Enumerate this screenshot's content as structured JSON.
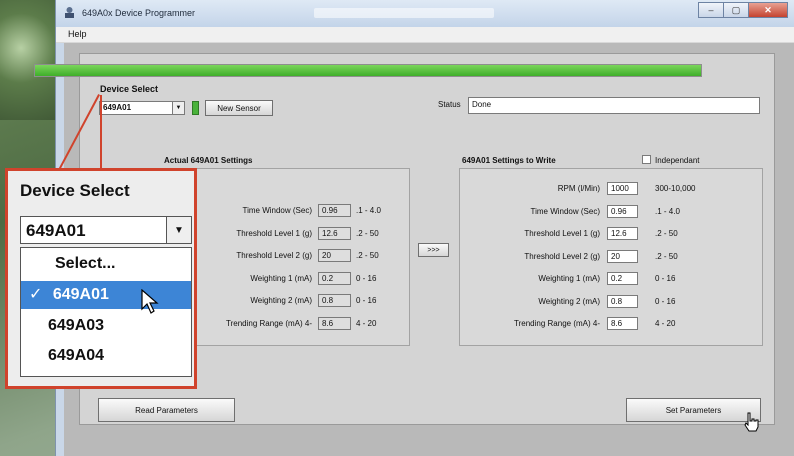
{
  "window": {
    "title": "649A0x Device Programmer"
  },
  "menu": {
    "help": "Help"
  },
  "progress": {
    "fraction": 1.0
  },
  "device_select": {
    "label": "Device Select",
    "selected": "649A01",
    "new_sensor_label": "New Sensor"
  },
  "status": {
    "label": "Status",
    "value": "Done"
  },
  "actual": {
    "heading": "Actual 649A01 Settings",
    "rows": [
      {
        "label": "Time Window (Sec)",
        "value": "0.96",
        "range": ".1 - 4.0"
      },
      {
        "label": "Threshold Level 1 (g)",
        "value": "12.6",
        "range": ".2 - 50"
      },
      {
        "label": "Threshold Level 2 (g)",
        "value": "20",
        "range": ".2 - 50"
      },
      {
        "label": "Weighting 1 (mA)",
        "value": "0.2",
        "range": "0 - 16"
      },
      {
        "label": "Weighting 2 (mA)",
        "value": "0.8",
        "range": "0 - 16"
      },
      {
        "label": "Trending Range (mA) 4-",
        "value": "8.6",
        "range": "4 - 20"
      }
    ]
  },
  "copy_button": ">>>",
  "write": {
    "heading": "649A01 Settings to Write",
    "independent_label": "Independant",
    "rows": [
      {
        "label": "RPM (l/Min)",
        "value": "1000",
        "range": "300-10,000"
      },
      {
        "label": "Time Window (Sec)",
        "value": "0.96",
        "range": ".1 - 4.0"
      },
      {
        "label": "Threshold Level 1 (g)",
        "value": "12.6",
        "range": ".2 - 50"
      },
      {
        "label": "Threshold Level 2 (g)",
        "value": "20",
        "range": ".2 - 50"
      },
      {
        "label": "Weighting 1 (mA)",
        "value": "0.2",
        "range": "0 - 16"
      },
      {
        "label": "Weighting 2 (mA)",
        "value": "0.8",
        "range": "0 - 16"
      },
      {
        "label": "Trending Range (mA) 4-",
        "value": "8.6",
        "range": "4 - 20"
      }
    ]
  },
  "buttons": {
    "read": "Read Parameters",
    "set": "Set Parameters"
  },
  "callout": {
    "title": "Device Select",
    "selected": "649A01",
    "options": [
      "Select...",
      "649A01",
      "649A03",
      "649A04"
    ],
    "checkmark": "✓",
    "highlighted_index": 1
  },
  "colors": {
    "progress": "#3fae2a",
    "callout_border": "#d0432c",
    "highlight": "#3d85d6"
  }
}
